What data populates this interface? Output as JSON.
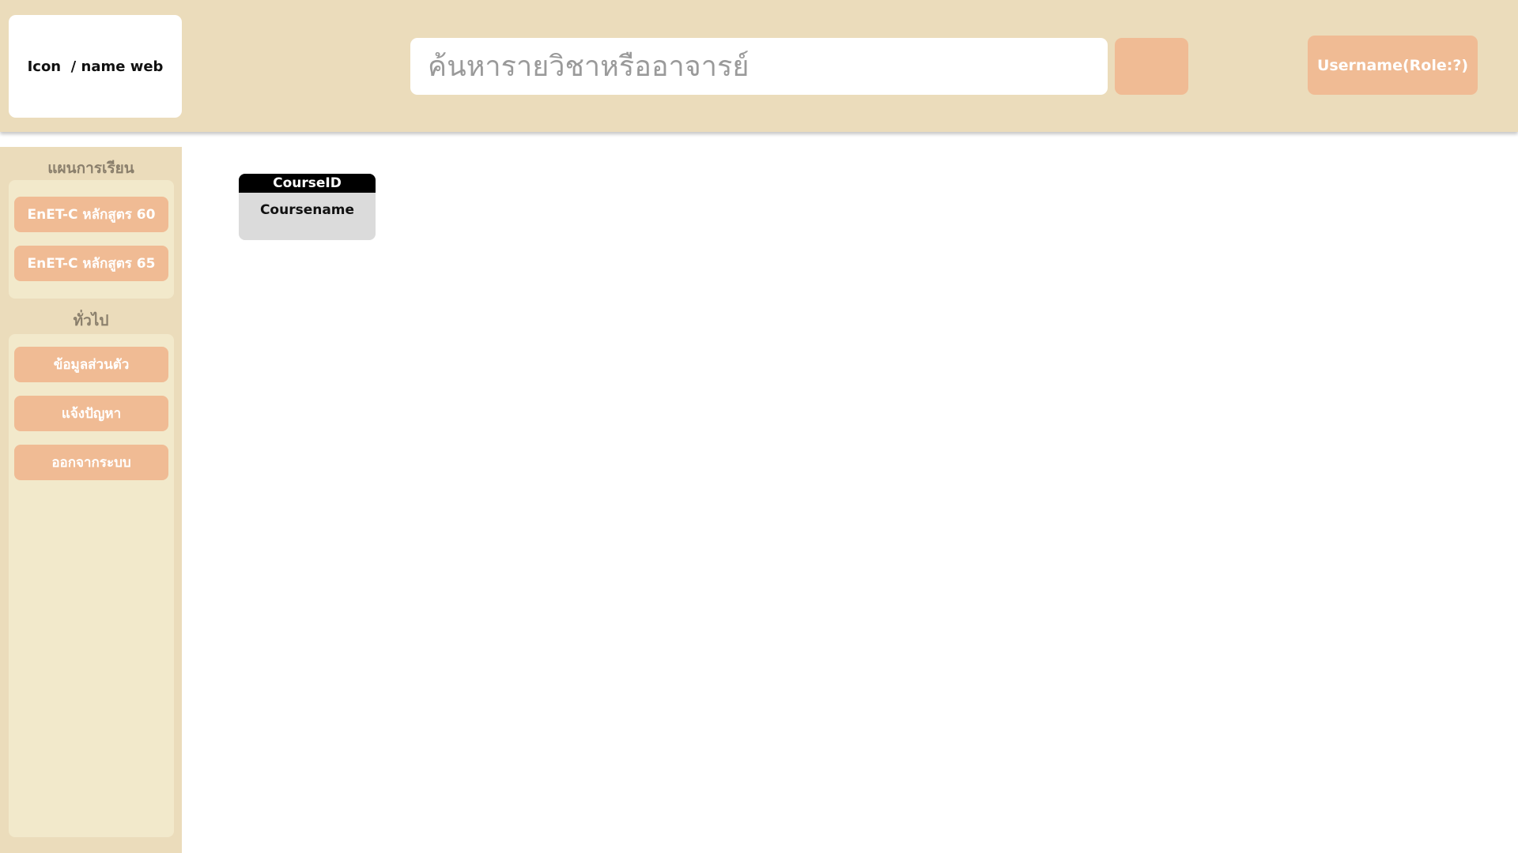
{
  "header": {
    "logo_text": "Icon  / name web",
    "search_placeholder": "ค้นหารายวิชาหรืออาจารย์",
    "search_button_label": "",
    "user_label": "Username(Role:?)"
  },
  "sidebar": {
    "sections": [
      {
        "heading": "แผนการเรียน",
        "items": [
          {
            "label": "EnET-C หลักสูตร 60"
          },
          {
            "label": "EnET-C หลักสูตร 65"
          }
        ]
      },
      {
        "heading": "ทั่วไป",
        "items": [
          {
            "label": "ข้อมูลส่วนตัว"
          },
          {
            "label": "แจ้งปัญหา"
          },
          {
            "label": "ออกจากระบบ"
          }
        ]
      }
    ]
  },
  "main": {
    "courses": [
      {
        "id": "CourseID",
        "name": "Coursename"
      }
    ]
  },
  "colors": {
    "header_bg": "#ebdcbb",
    "panel_bg": "#f2e9cb",
    "accent": "#f0bb94",
    "course_header": "#000000",
    "course_body": "#dbdbdb"
  }
}
